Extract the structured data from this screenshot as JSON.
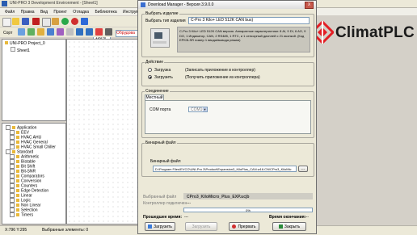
{
  "ide": {
    "title": "UNI-PRO 3 Development Environment - [Sheet1]",
    "menu": [
      "Файл",
      "Правка",
      "Вид",
      "Проект",
      "Отладка",
      "Библиотека",
      "Инструменты"
    ],
    "zoom": "100%",
    "toolbar2_left": "Сорт",
    "toolbar2_mid": "Обрудова",
    "project_tree": [
      {
        "label": "UNI-PRO Project_0"
      },
      {
        "label": "Sheet1"
      }
    ],
    "library_tree": [
      "Application",
      "EEV",
      "HVAC AHU",
      "HVAC General",
      "HVAC Small Chiller",
      "Standard",
      "Arithmetic",
      "Bistable",
      "Bit Shift",
      "Bit-SNR",
      "Comparators",
      "Conversion",
      "Counters",
      "Edge Detection",
      "Linear",
      "Logic",
      "Non Linear",
      "Selection",
      "Timers"
    ],
    "status_coords": "X:796 Y:295",
    "status_selected": "Выбранные элементы: 0"
  },
  "logo": {
    "text": "ClimatPLC",
    "brand_color": "#e31e24"
  },
  "dialog": {
    "title": "Download Manager - Версия 3.9.0.0",
    "close_label": "X",
    "product_group": "Выбрать изделие",
    "product_label": "Выбрать тип изделия",
    "product_value": "C-Pro 3 Kilo+ LED 512K CAN bus)",
    "product_desc": "C-Pro 3 Kilo+ LED 512K CAN версия. Аппаратные характеристики: 8 AI, 9 DI, 6 AO, 9 DO, 1 Индикатор, CAN, 2 RS485, 1 RTC, и 1 сенсорный дисплей с 21 иконкой. (Код EPK3LSR номер 1 ввода/вывода режим)",
    "action_group": "Действие",
    "radio_load": "Загрузка",
    "radio_load_hint": "(Записать приложение в контроллер)",
    "radio_upload": "Загрузить",
    "radio_upload_hint": "(Получить приложение из контроллера)",
    "connection_group": "Соединение",
    "tab_local": "Местный",
    "com_label": "COM порта",
    "com_value": "COM16",
    "binary_group": "Бинарный файл",
    "binary_label": "Бинарный файл",
    "binary_path": "D:\\Program Files\\EVCO\\UNI-Pro 3\\Product\\Expansion3_KiloPlus_CAN.w16.CN\\CPro3_KiloMic",
    "browse_label": "...",
    "selected_file_label": "Выбранный файл",
    "selected_file_value": "CPro3_KiloMicro_Plus_EXP.ucjb",
    "controller_label": "Контроллер подключен",
    "controller_value": "---",
    "progress_text": "0%",
    "progress_fraction": 0.0,
    "elapsed_label": "Прошедшее время:",
    "elapsed_value": "---",
    "remaining_label": "Время окончания:",
    "remaining_value": "---",
    "btn_load": "Загрузить",
    "btn_stop": "Прервать",
    "btn_upload": "Загрузить",
    "btn_close": "Закрыть"
  }
}
